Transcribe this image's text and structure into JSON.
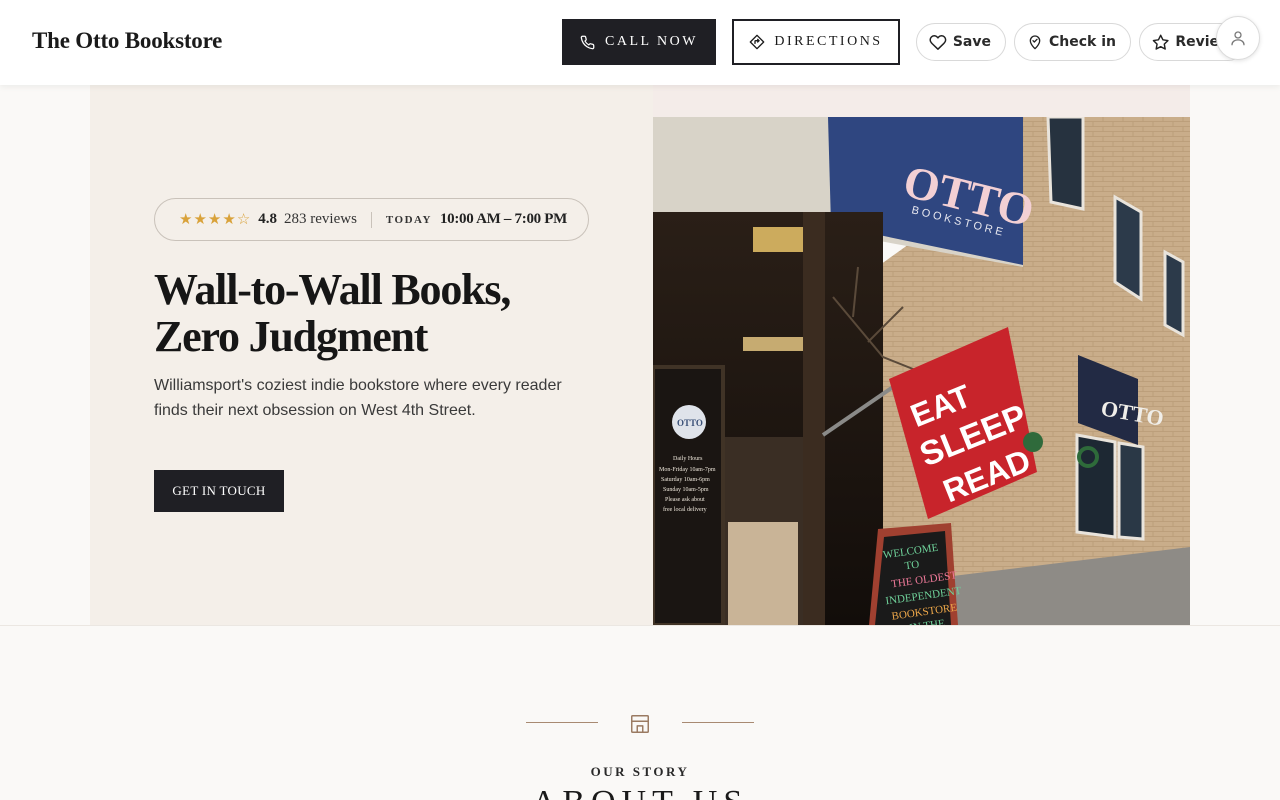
{
  "header": {
    "brand": "The Otto Bookstore",
    "call_label": "CALL NOW",
    "directions_label": "DIRECTIONS",
    "save_label": "Save",
    "checkin_label": "Check in",
    "review_label": "Review"
  },
  "hero": {
    "rating": "4.8",
    "rating_stars": 4.5,
    "review_count": "283 reviews",
    "today_label": "TODAY",
    "hours": "10:00 AM – 7:00 PM",
    "title_line1": "Wall-to-Wall Books,",
    "title_line2": "Zero Judgment",
    "subtitle": "Williamsport's coziest indie bookstore where every reader finds their next obsession on West 4th Street.",
    "cta_label": "GET IN TOUCH",
    "photo": {
      "storefront_sign": "OTTO",
      "storefront_sign_sub": "BOOKSTORE",
      "flag_words": [
        "EAT",
        "SLEEP",
        "READ"
      ],
      "chalkboard_lines": [
        "WELCOME",
        "TO",
        "THE OLDEST",
        "INDEPENDENT",
        "BOOKSTORE",
        "IN THE"
      ],
      "window_hours_lines": [
        "Daily Hours",
        "Mon-Friday 10am-7pm",
        "Saturday 10am-6pm",
        "Sunday 10am-5pm",
        "Please ask about",
        "free local delivery"
      ]
    }
  },
  "about": {
    "eyebrow": "OUR STORY",
    "title": "ABOUT US"
  },
  "colors": {
    "accent_dark": "#1f1f24",
    "hero_bg": "#f4efe9",
    "star": "#d9a23a",
    "flag_red": "#c8242b",
    "divider_tan": "#a88a72"
  }
}
